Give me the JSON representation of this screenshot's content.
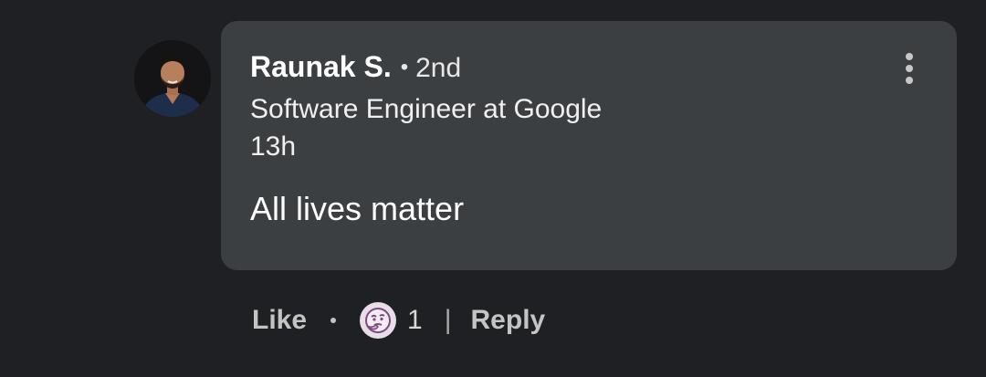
{
  "comment": {
    "author_name": "Raunak S.",
    "separator": "•",
    "connection_degree": "2nd",
    "headline": "Software Engineer at Google",
    "timestamp": "13h",
    "text": "All lives matter",
    "more_icon": "more-vertical-icon",
    "avatar_icon": "profile-photo"
  },
  "actions": {
    "like_label": "Like",
    "reaction_icon": "curious-reaction-icon",
    "reaction_count": "1",
    "divider": "|",
    "reply_label": "Reply"
  },
  "colors": {
    "background": "#1f2023",
    "bubble": "#3c3f42",
    "text_primary": "#ffffff",
    "text_secondary": "#c4c4c4",
    "reaction_badge": "#e9ddea"
  }
}
